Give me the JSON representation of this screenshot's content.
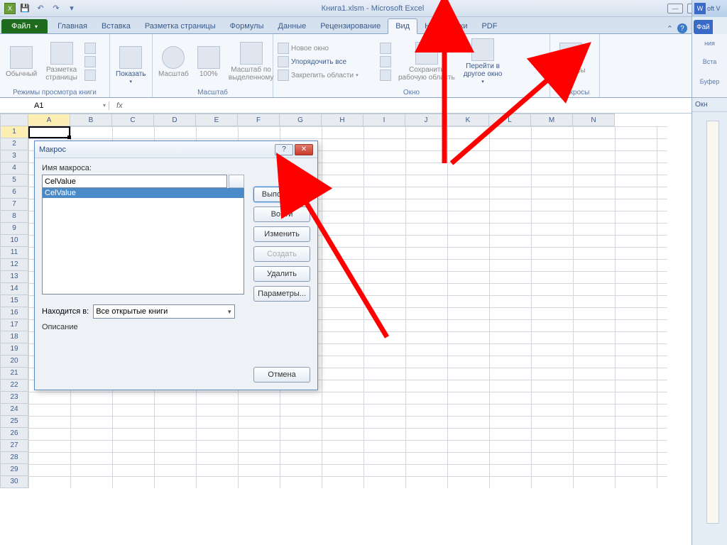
{
  "window": {
    "title": "Книга1.xlsm - Microsoft Excel"
  },
  "tabs": {
    "file": "Файл",
    "items": [
      "Главная",
      "Вставка",
      "Разметка страницы",
      "Формулы",
      "Данные",
      "Рецензирование",
      "Вид",
      "Надстройки",
      "PDF"
    ],
    "active_index": 6
  },
  "ribbon": {
    "group_views": {
      "label": "Режимы просмотра книги",
      "normal": "Обычный",
      "page_layout": "Разметка\nстраницы",
      "show": "Показать"
    },
    "group_zoom": {
      "label": "Масштаб",
      "zoom": "Масштаб",
      "hundred": "100%",
      "to_selection": "Масштаб по\nвыделенному"
    },
    "group_window": {
      "label": "Окно",
      "new_window": "Новое окно",
      "arrange_all": "Упорядочить все",
      "freeze": "Закрепить области",
      "save_workspace": "Сохранить\nрабочую область",
      "switch_windows": "Перейти в\nдругое окно"
    },
    "group_macros": {
      "label": "Макросы",
      "macros": "Макросы"
    }
  },
  "namebox": "A1",
  "grid": {
    "columns": [
      "A",
      "B",
      "C",
      "D",
      "E",
      "F",
      "G",
      "H",
      "I",
      "J",
      "K",
      "L",
      "M",
      "N"
    ],
    "rows": 30,
    "active": "A1"
  },
  "dialog": {
    "title": "Макрос",
    "name_label": "Имя макроса:",
    "name_value": "CelValue",
    "list_items": [
      "CelValue"
    ],
    "location_label": "Находится в:",
    "location_value": "Все открытые книги",
    "description_label": "Описание",
    "buttons": {
      "run": "Выполнить",
      "step": "Войти",
      "edit": "Изменить",
      "create": "Создать",
      "delete": "Удалить",
      "options": "Параметры...",
      "cancel": "Отмена"
    }
  },
  "word": {
    "suffix": "oft V",
    "file": "Фай",
    "paste": "Вста",
    "clipboard": "Буфер",
    "links": "ния",
    "windows": "Окн"
  }
}
